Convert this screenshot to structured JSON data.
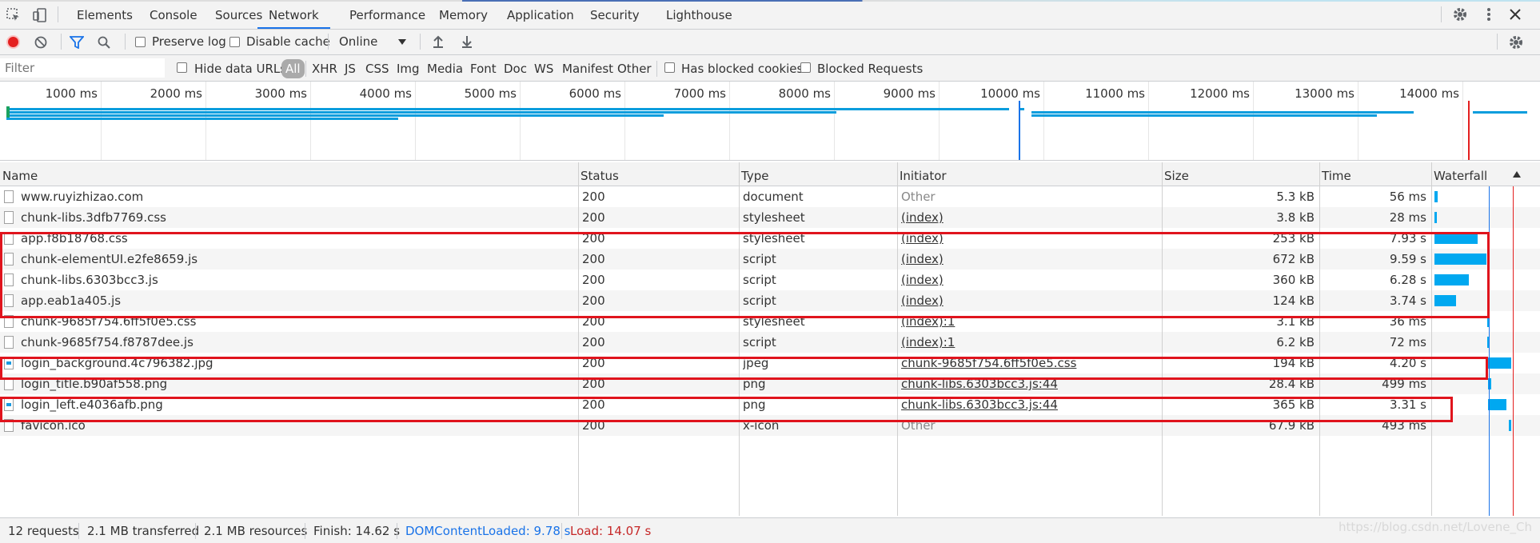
{
  "tabs": [
    "Elements",
    "Console",
    "Sources",
    "Network",
    "Performance",
    "Memory",
    "Application",
    "Security",
    "Lighthouse"
  ],
  "active_tab": "Network",
  "toolbar": {
    "preserve_log": "Preserve log",
    "disable_cache": "Disable cache",
    "throttle": "Online"
  },
  "filterbar": {
    "placeholder": "Filter",
    "hide_data_urls": "Hide data URLs",
    "types": [
      "All",
      "XHR",
      "JS",
      "CSS",
      "Img",
      "Media",
      "Font",
      "Doc",
      "WS",
      "Manifest",
      "Other"
    ],
    "has_blocked_cookies": "Has blocked cookies",
    "blocked_requests": "Blocked Requests"
  },
  "overview": {
    "ticks": [
      "1000 ms",
      "2000 ms",
      "3000 ms",
      "4000 ms",
      "5000 ms",
      "6000 ms",
      "7000 ms",
      "8000 ms",
      "9000 ms",
      "10000 ms",
      "11000 ms",
      "12000 ms",
      "13000 ms",
      "14000 ms",
      "150"
    ]
  },
  "columns": {
    "name": "Name",
    "status": "Status",
    "type": "Type",
    "initiator": "Initiator",
    "size": "Size",
    "time": "Time",
    "waterfall": "Waterfall"
  },
  "requests": [
    {
      "name": "www.ruyizhizao.com",
      "status": "200",
      "type": "document",
      "initiator": "Other",
      "initiator_link": false,
      "size": "5.3 kB",
      "time": "56 ms",
      "wf_start": 0.0,
      "wf_width": 0.04,
      "icon": "file"
    },
    {
      "name": "chunk-libs.3dfb7769.css",
      "status": "200",
      "type": "stylesheet",
      "initiator": "(index)",
      "initiator_link": true,
      "size": "3.8 kB",
      "time": "28 ms",
      "wf_start": 0.0,
      "wf_width": 0.03,
      "icon": "file"
    },
    {
      "name": "app.f8b18768.css",
      "status": "200",
      "type": "stylesheet",
      "initiator": "(index)",
      "initiator_link": true,
      "size": "253 kB",
      "time": "7.93 s",
      "wf_start": 0.0,
      "wf_width": 0.56,
      "icon": "file"
    },
    {
      "name": "chunk-elementUI.e2fe8659.js",
      "status": "200",
      "type": "script",
      "initiator": "(index)",
      "initiator_link": true,
      "size": "672 kB",
      "time": "9.59 s",
      "wf_start": 0.0,
      "wf_width": 0.68,
      "icon": "file"
    },
    {
      "name": "chunk-libs.6303bcc3.js",
      "status": "200",
      "type": "script",
      "initiator": "(index)",
      "initiator_link": true,
      "size": "360 kB",
      "time": "6.28 s",
      "wf_start": 0.0,
      "wf_width": 0.45,
      "icon": "file"
    },
    {
      "name": "app.eab1a405.js",
      "status": "200",
      "type": "script",
      "initiator": "(index)",
      "initiator_link": true,
      "size": "124 kB",
      "time": "3.74 s",
      "wf_start": 0.0,
      "wf_width": 0.28,
      "icon": "file"
    },
    {
      "name": "chunk-9685f754.6ff5f0e5.css",
      "status": "200",
      "type": "stylesheet",
      "initiator": "(index):1",
      "initiator_link": true,
      "size": "3.1 kB",
      "time": "36 ms",
      "wf_start": 0.69,
      "wf_width": 0.02,
      "icon": "file"
    },
    {
      "name": "chunk-9685f754.f8787dee.js",
      "status": "200",
      "type": "script",
      "initiator": "(index):1",
      "initiator_link": true,
      "size": "6.2 kB",
      "time": "72 ms",
      "wf_start": 0.69,
      "wf_width": 0.02,
      "icon": "file"
    },
    {
      "name": "login_background.4c796382.jpg",
      "status": "200",
      "type": "jpeg",
      "initiator": "chunk-9685f754.6ff5f0e5.css",
      "initiator_link": true,
      "size": "194 kB",
      "time": "4.20 s",
      "wf_start": 0.7,
      "wf_width": 0.3,
      "icon": "img"
    },
    {
      "name": "login_title.b90af558.png",
      "status": "200",
      "type": "png",
      "initiator": "chunk-libs.6303bcc3.js:44",
      "initiator_link": true,
      "size": "28.4 kB",
      "time": "499 ms",
      "wf_start": 0.7,
      "wf_width": 0.04,
      "icon": "file"
    },
    {
      "name": "login_left.e4036afb.png",
      "status": "200",
      "type": "png",
      "initiator": "chunk-libs.6303bcc3.js:44",
      "initiator_link": true,
      "size": "365 kB",
      "time": "3.31 s",
      "wf_start": 0.7,
      "wf_width": 0.24,
      "icon": "img"
    },
    {
      "name": "favicon.ico",
      "status": "200",
      "type": "x-icon",
      "initiator": "Other",
      "initiator_link": false,
      "size": "67.9 kB",
      "time": "493 ms",
      "wf_start": 0.97,
      "wf_width": 0.03,
      "icon": "file"
    }
  ],
  "status": {
    "requests": "12 requests",
    "transferred": "2.1 MB transferred",
    "resources": "2.1 MB resources",
    "finish": "Finish: 14.62 s",
    "dcl": "DOMContentLoaded: 9.78 s",
    "load": "Load: 14.07 s"
  },
  "watermark": "https://blog.csdn.net/Lovene_Ch",
  "colors": {
    "accent": "#1a73e8",
    "dcl": "#1a73e8",
    "load": "#c62828",
    "highlight": "#e0141d",
    "bar": "#00a8f0"
  }
}
